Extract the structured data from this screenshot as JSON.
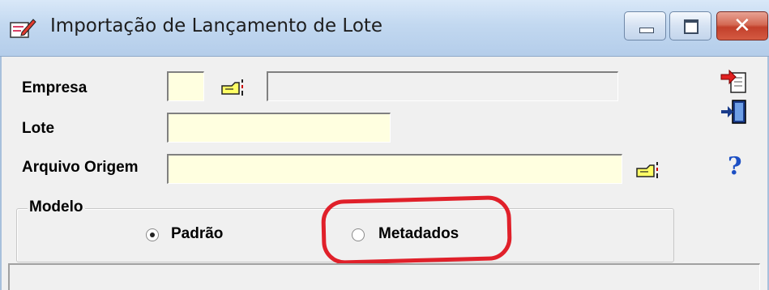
{
  "window": {
    "title": "Importação de Lançamento de Lote",
    "icon": "edit-pencil-icon",
    "buttons": {
      "minimize": "minimize-icon",
      "maximize": "maximize-icon",
      "close": "close-icon"
    }
  },
  "form": {
    "empresa": {
      "label": "Empresa",
      "code_value": "",
      "name_value": ""
    },
    "lote": {
      "label": "Lote",
      "value": ""
    },
    "arquivo_origem": {
      "label": "Arquivo Origem",
      "value": ""
    }
  },
  "modelo": {
    "label": "Modelo",
    "options": [
      {
        "label": "Padrão",
        "checked": true
      },
      {
        "label": "Metadados",
        "checked": false
      }
    ]
  },
  "side_toolbar": [
    "import-document-icon",
    "exit-door-icon",
    "help-question-icon"
  ],
  "colors": {
    "field_bg": "#ffffe0",
    "highlight": "#e0202a",
    "title_bg": "#c2d8f0"
  }
}
